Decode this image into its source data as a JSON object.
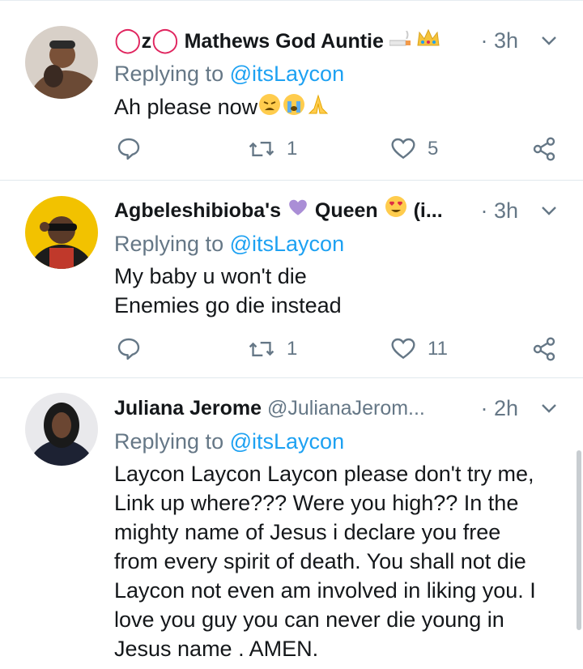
{
  "tweets": [
    {
      "name_prefix": "OzO",
      "name": "Mathews God Auntie",
      "time": "· 3h",
      "reply_prefix": "Replying to",
      "reply_to": "@itsLaycon",
      "body": [
        "Ah please now"
      ],
      "retweets": "1",
      "likes": "5"
    },
    {
      "name": "Agbeleshibioba's",
      "name_suffix": "Queen",
      "name_trunc": "(i...",
      "time": "· 3h",
      "reply_prefix": "Replying to",
      "reply_to": "@itsLaycon",
      "body": [
        "My baby u won't die",
        "Enemies go die instead"
      ],
      "retweets": "1",
      "likes": "11"
    },
    {
      "name": "Juliana Jerome",
      "handle": "@JulianaJerom...",
      "time": "· 2h",
      "reply_prefix": "Replying to",
      "reply_to": "@itsLaycon",
      "body": [
        "Laycon Laycon Laycon please don't try me,",
        "Link up where??? Were you high?? In the",
        "mighty name of Jesus i declare you free",
        "from every spirit of death. You shall not die",
        "Laycon not even am involved in liking you. I",
        "love you guy you can never die young in",
        "Jesus name . AMEN."
      ]
    }
  ],
  "colors": {
    "secondary": "#657786",
    "link": "#1da1f2",
    "text": "#14171a",
    "divider": "#e1e8ed"
  },
  "icons": [
    "reply-icon",
    "retweet-icon",
    "like-icon",
    "share-icon",
    "chevron-down-icon"
  ]
}
